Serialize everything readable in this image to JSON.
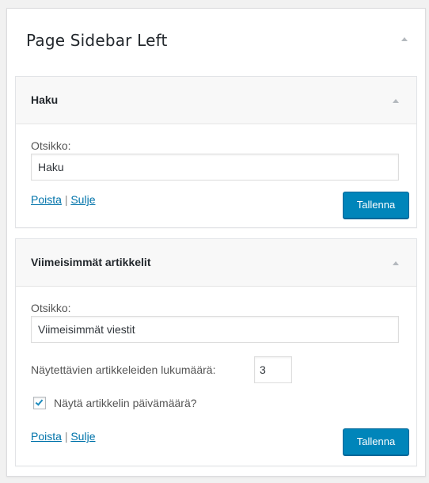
{
  "sidebar": {
    "title": "Page Sidebar Left"
  },
  "widgets": [
    {
      "title": "Haku",
      "title_label": "Otsikko:",
      "title_value": "Haku",
      "delete_label": "Poista",
      "separator": "|",
      "close_label": "Sulje",
      "save_label": "Tallenna"
    },
    {
      "title": "Viimeisimmät artikkelit",
      "title_label": "Otsikko:",
      "title_value": "Viimeisimmät viestit",
      "count_label": "Näytettävien artikkeleiden lukumäärä:",
      "count_value": "3",
      "show_date_label": "Näytä artikkelin päivämäärä?",
      "show_date_checked": true,
      "delete_label": "Poista",
      "separator": "|",
      "close_label": "Sulje",
      "save_label": "Tallenna"
    }
  ],
  "colors": {
    "primary_button": "#0085ba",
    "link": "#0073aa"
  }
}
